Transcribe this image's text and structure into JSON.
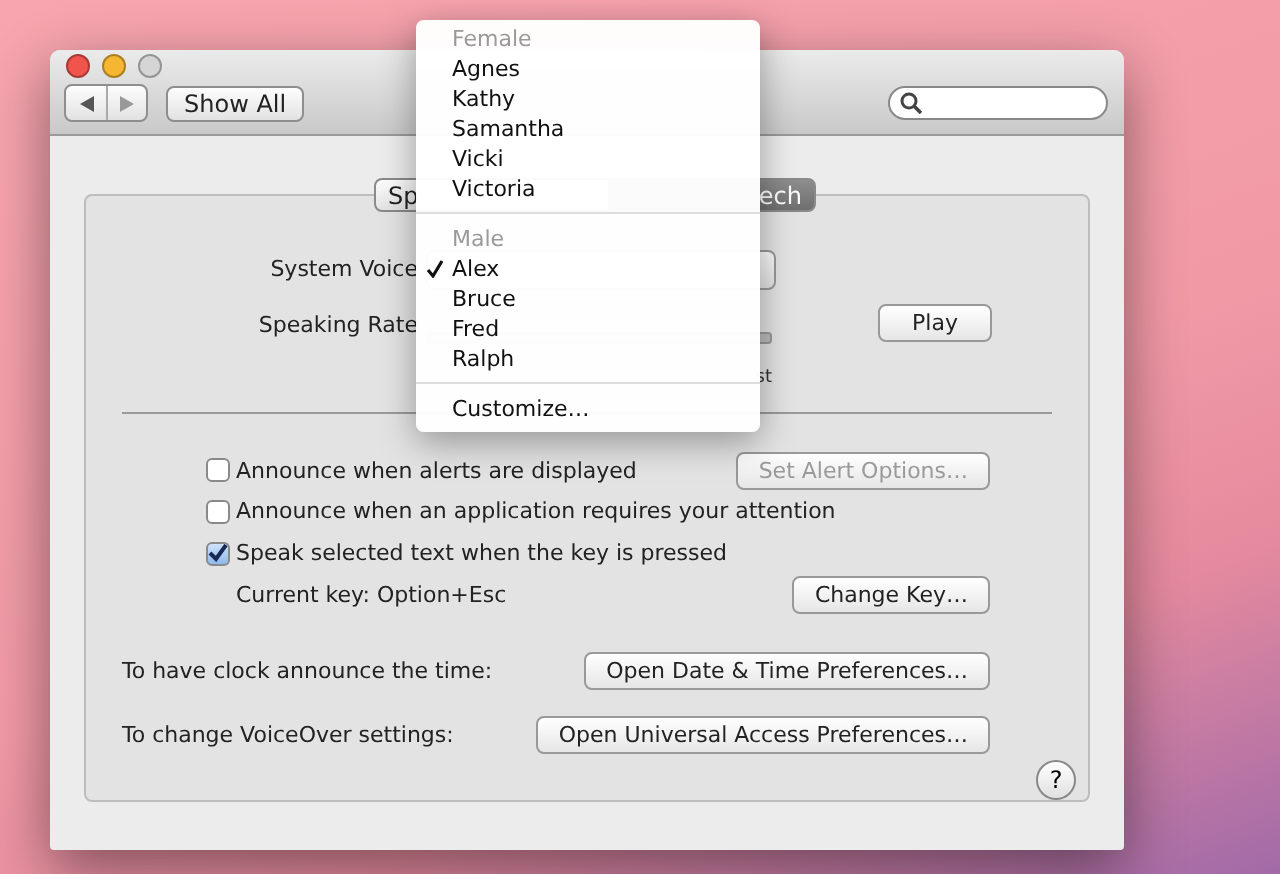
{
  "window": {
    "show_all": "Show All"
  },
  "tabs": [
    {
      "label": "Sp",
      "selected": false
    },
    {
      "label": "ech",
      "selected": true
    }
  ],
  "voice": {
    "label": "System Voice"
  },
  "rate": {
    "label": "Speaking Rate",
    "end_label": "st"
  },
  "play": "Play",
  "options": [
    {
      "label": "Announce when alerts are displayed",
      "checked": false,
      "button": {
        "label": "Set Alert Options…",
        "disabled": true
      }
    },
    {
      "label": "Announce when an application requires your attention",
      "checked": false
    },
    {
      "label": "Speak selected text when the key is pressed",
      "checked": true,
      "note": "Current key: Option+Esc",
      "button": {
        "label": "Change Key…",
        "disabled": false
      }
    }
  ],
  "links": [
    {
      "label": "To have clock announce the time:",
      "button": "Open Date & Time Preferences…"
    },
    {
      "label": "To change VoiceOver settings:",
      "button": "Open Universal Access Preferences…"
    }
  ],
  "help": "?",
  "menu": {
    "sections": [
      {
        "heading": "Female",
        "items": [
          {
            "label": "Agnes",
            "selected": false
          },
          {
            "label": "Kathy",
            "selected": false
          },
          {
            "label": "Samantha",
            "selected": false
          },
          {
            "label": "Vicki",
            "selected": false
          },
          {
            "label": "Victoria",
            "selected": false
          }
        ]
      },
      {
        "heading": "Male",
        "items": [
          {
            "label": "Alex",
            "selected": true
          },
          {
            "label": "Bruce",
            "selected": false
          },
          {
            "label": "Fred",
            "selected": false
          },
          {
            "label": "Ralph",
            "selected": false
          }
        ]
      }
    ],
    "footer": "Customize…"
  }
}
